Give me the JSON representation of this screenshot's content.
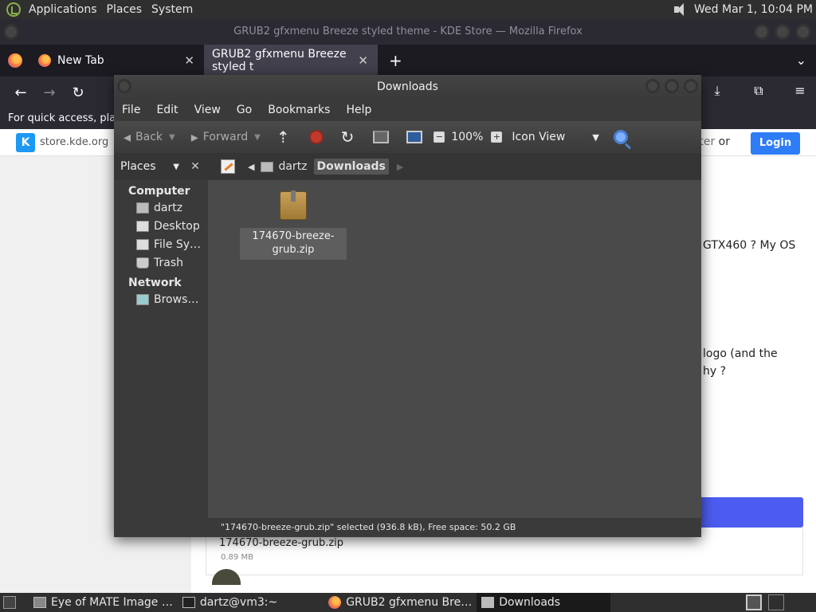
{
  "top_panel": {
    "applications": "Applications",
    "places": "Places",
    "system": "System",
    "clock": "Wed Mar  1, 10:04 PM"
  },
  "firefox": {
    "window_title": "GRUB2 gfxmenu Breeze styled theme - KDE Store — Mozilla Firefox",
    "tabs": [
      {
        "label": "New Tab",
        "close": "✕"
      },
      {
        "label": "GRUB2 gfxmenu Breeze styled t",
        "close": "✕"
      }
    ],
    "new_tab": "+",
    "bookmarks_hint": "For quick access, place",
    "site": "store.kde.org",
    "register": "gister",
    "or": "or",
    "login": "Login",
    "page_text": {
      "line1": "GTX460 ? My OS",
      "line2": "logo (and the",
      "line3": "hy ?"
    },
    "download": {
      "name": "174670-breeze-grub.zip",
      "size": "0.89 MB"
    }
  },
  "file_manager": {
    "title": "Downloads",
    "menu": [
      "File",
      "Edit",
      "View",
      "Go",
      "Bookmarks",
      "Help"
    ],
    "toolbar": {
      "back": "Back",
      "forward": "Forward",
      "zoom": "100%",
      "zoom_out": "−",
      "zoom_in": "+",
      "view_mode": "Icon View"
    },
    "location": {
      "places_label": "Places",
      "close": "✕",
      "crumbs": [
        "dartz",
        "Downloads"
      ]
    },
    "sidebar": {
      "computer_heading": "Computer",
      "computer_items": [
        "dartz",
        "Desktop",
        "File Sy…",
        "Trash"
      ],
      "network_heading": "Network",
      "network_items": [
        "Brows…"
      ]
    },
    "file": {
      "label": "174670-breeze-grub.zip"
    },
    "status": "\"174670-breeze-grub.zip\" selected (936.8 kB), Free space: 50.2 GB"
  },
  "bottom_panel": {
    "tasks": [
      "Eye of MATE Image …",
      "dartz@vm3:~",
      "GRUB2 gfxmenu Bre…",
      "Downloads"
    ]
  }
}
